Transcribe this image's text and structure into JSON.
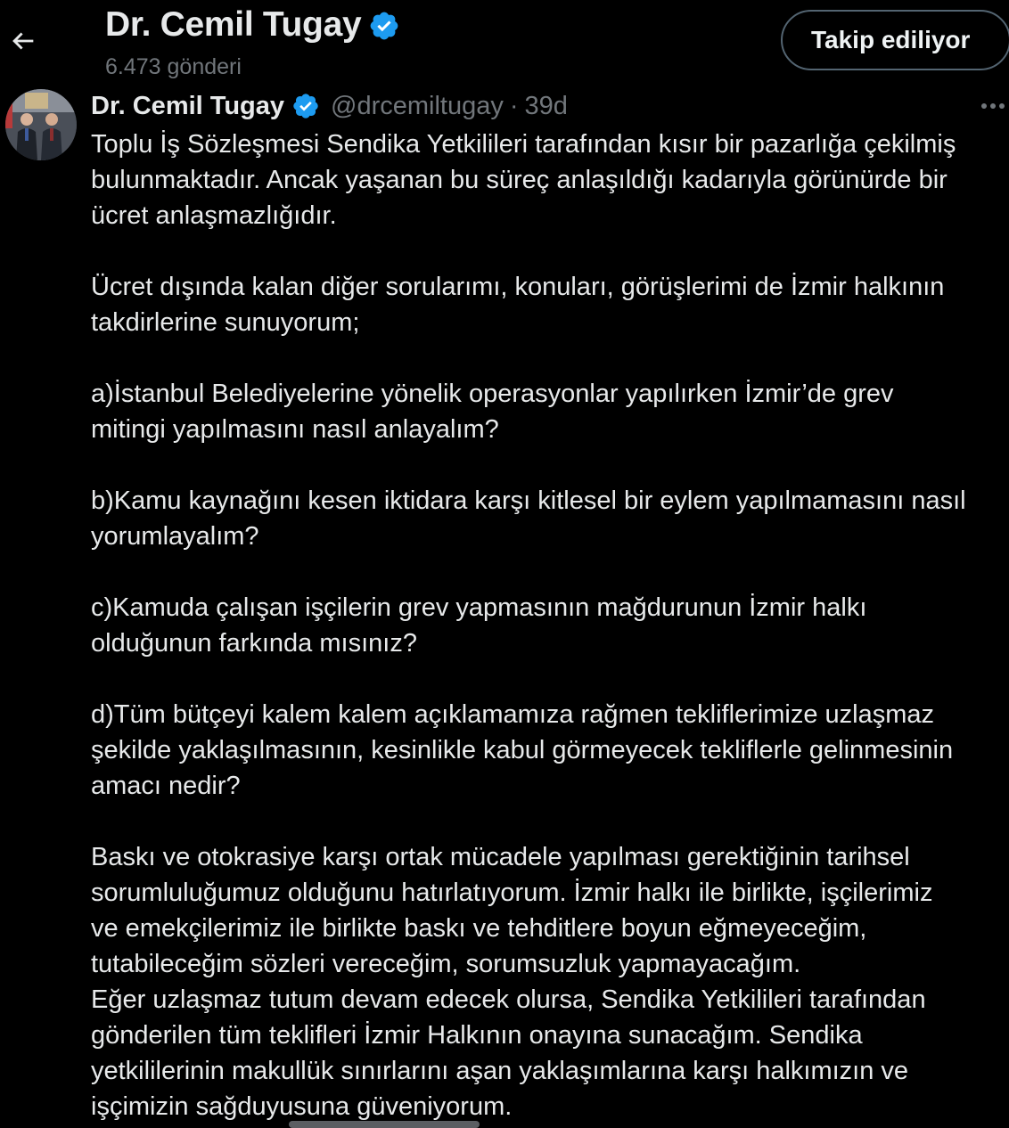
{
  "header": {
    "title": "Dr. Cemil Tugay",
    "post_count": "6.473 gönderi",
    "follow_label": "Takip ediliyor"
  },
  "tweet": {
    "author_name": "Dr. Cemil Tugay",
    "handle": "@drcemiltugay",
    "separator": "·",
    "time": "39d",
    "lines": [
      "Toplu İş Sözleşmesi Sendika Yetkilileri tarafından kısır bir pazarlığa çekilmiş",
      "bulunmaktadır. Ancak yaşanan bu süreç anlaşıldığı kadarıyla görünürde bir",
      "ücret anlaşmazlığıdır.",
      "",
      "Ücret dışında kalan diğer sorularımı, konuları, görüşlerimi de İzmir halkının",
      "takdirlerine sunuyorum;",
      "",
      "a)İstanbul Belediyelerine yönelik operasyonlar yapılırken İzmir’de grev",
      "mitingi yapılmasını nasıl anlayalım?",
      "",
      "b)Kamu kaynağını kesen iktidara karşı kitlesel bir eylem yapılmamasını nasıl",
      "yorumlayalım?",
      "",
      "c)Kamuda çalışan işçilerin grev yapmasının mağdurunun İzmir halkı",
      "olduğunun farkında mısınız?",
      "",
      "d)Tüm bütçeyi kalem kalem açıklamamıza rağmen tekliflerimize uzlaşmaz",
      "şekilde yaklaşılmasının, kesinlikle kabul görmeyecek tekliflerle gelinmesinin",
      "amacı nedir?",
      "",
      "Baskı ve otokrasiye karşı ortak mücadele yapılması gerektiğinin tarihsel",
      "sorumluluğumuz olduğunu hatırlatıyorum. İzmir halkı ile birlikte, işçilerimiz",
      "ve emekçilerimiz ile birlikte baskı ve tehditlere boyun eğmeyeceğim,",
      "tutabileceğim sözleri vereceğim, sorumsuzluk yapmayacağım.",
      "Eğer uzlaşmaz tutum devam edecek olursa, Sendika Yetkilileri tarafından",
      "gönderilen tüm teklifleri İzmir Halkının onayına sunacağım. Sendika",
      "yetkililerinin makullük sınırlarını aşan yaklaşımlarına karşı halkımızın ve",
      "işçimizin sağduyusuna güveniyorum."
    ]
  },
  "icons": {
    "back": "arrow-left-icon",
    "verified": "verified-badge-icon",
    "more": "more-horizontal-icon"
  },
  "colors": {
    "background": "#000000",
    "text": "#e7e9ea",
    "muted": "#71767b",
    "verified": "#1d9bf0",
    "button_border": "#536471"
  }
}
